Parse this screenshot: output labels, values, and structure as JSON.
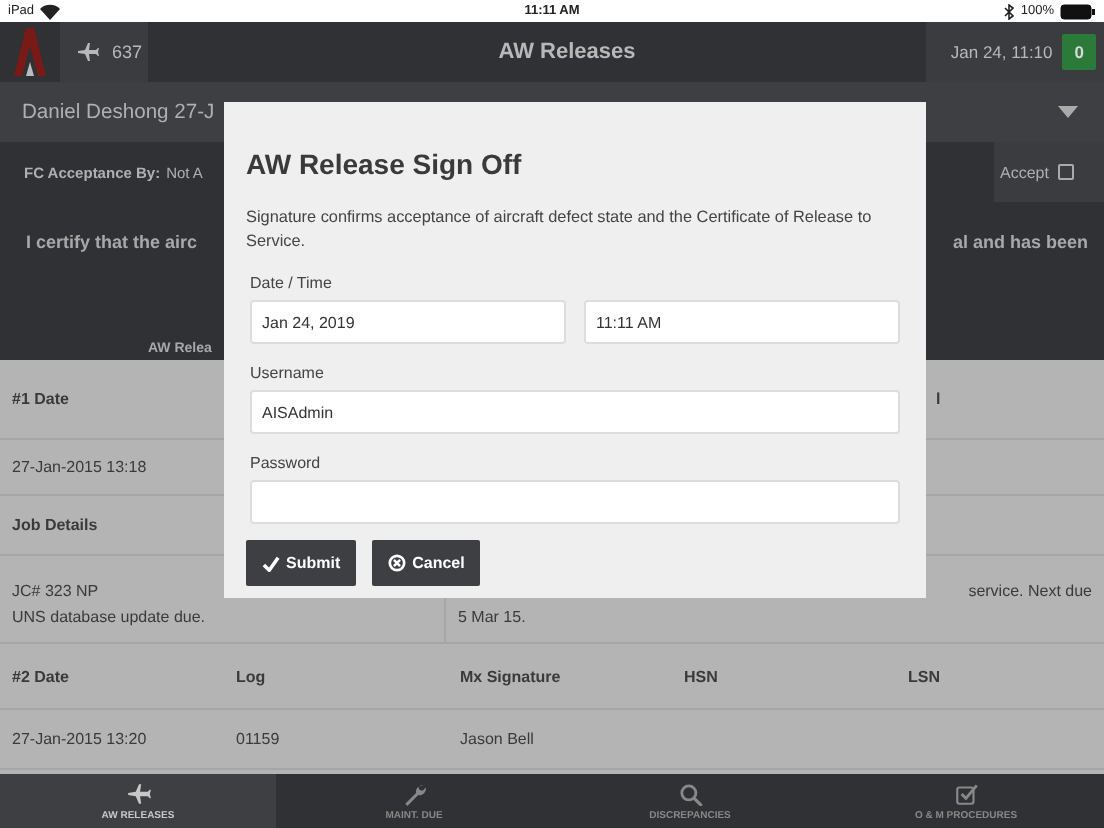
{
  "status_bar": {
    "device": "iPad",
    "time": "11:11 AM",
    "battery": "100%"
  },
  "header": {
    "aircraft": "637",
    "title": "AW Releases",
    "datetime": "Jan 24, 11:10",
    "badge": "0"
  },
  "subheader": {
    "text": "Daniel Deshong 27-J"
  },
  "acceptance": {
    "label": "FC Acceptance By:",
    "value": "Not A",
    "accept_label": "Accept",
    "checked": false
  },
  "certification": {
    "left": "I certify that the airc",
    "right": "al and has been",
    "caption": "AW Relea"
  },
  "release_1": {
    "columns": [
      "#1 Date",
      "l"
    ],
    "row": [
      "27-Jan-2015 13:18"
    ],
    "job_heading": "Job Details",
    "job_left": [
      "JC# 323 NP",
      "UNS database update due."
    ],
    "job_right": [
      "service. Next due",
      "5 Mar 15."
    ]
  },
  "release_2": {
    "columns": [
      "#2 Date",
      "Log",
      "Mx Signature",
      "HSN",
      "LSN"
    ],
    "row": [
      "27-Jan-2015 13:20",
      "01159",
      "Jason Bell"
    ]
  },
  "dialog": {
    "title": "AW Release Sign Off",
    "description": "Signature confirms acceptance of aircraft defect state and the Certificate of Release to Service.",
    "date_label": "Date / Time",
    "date": "Jan 24, 2019",
    "time": "11:11 AM",
    "username_label": "Username",
    "username": "AISAdmin",
    "password_label": "Password",
    "buttons": [
      {
        "kind": "submit",
        "label": "Submit"
      },
      {
        "kind": "cancel",
        "label": "Cancel"
      }
    ]
  },
  "tabs": [
    {
      "label": "AW RELEASES",
      "selected": true
    },
    {
      "label": "MAINT. DUE",
      "selected": false
    },
    {
      "label": "DISCREPANCIES",
      "selected": false
    },
    {
      "label": "O & M PROCEDURES",
      "selected": false
    }
  ]
}
